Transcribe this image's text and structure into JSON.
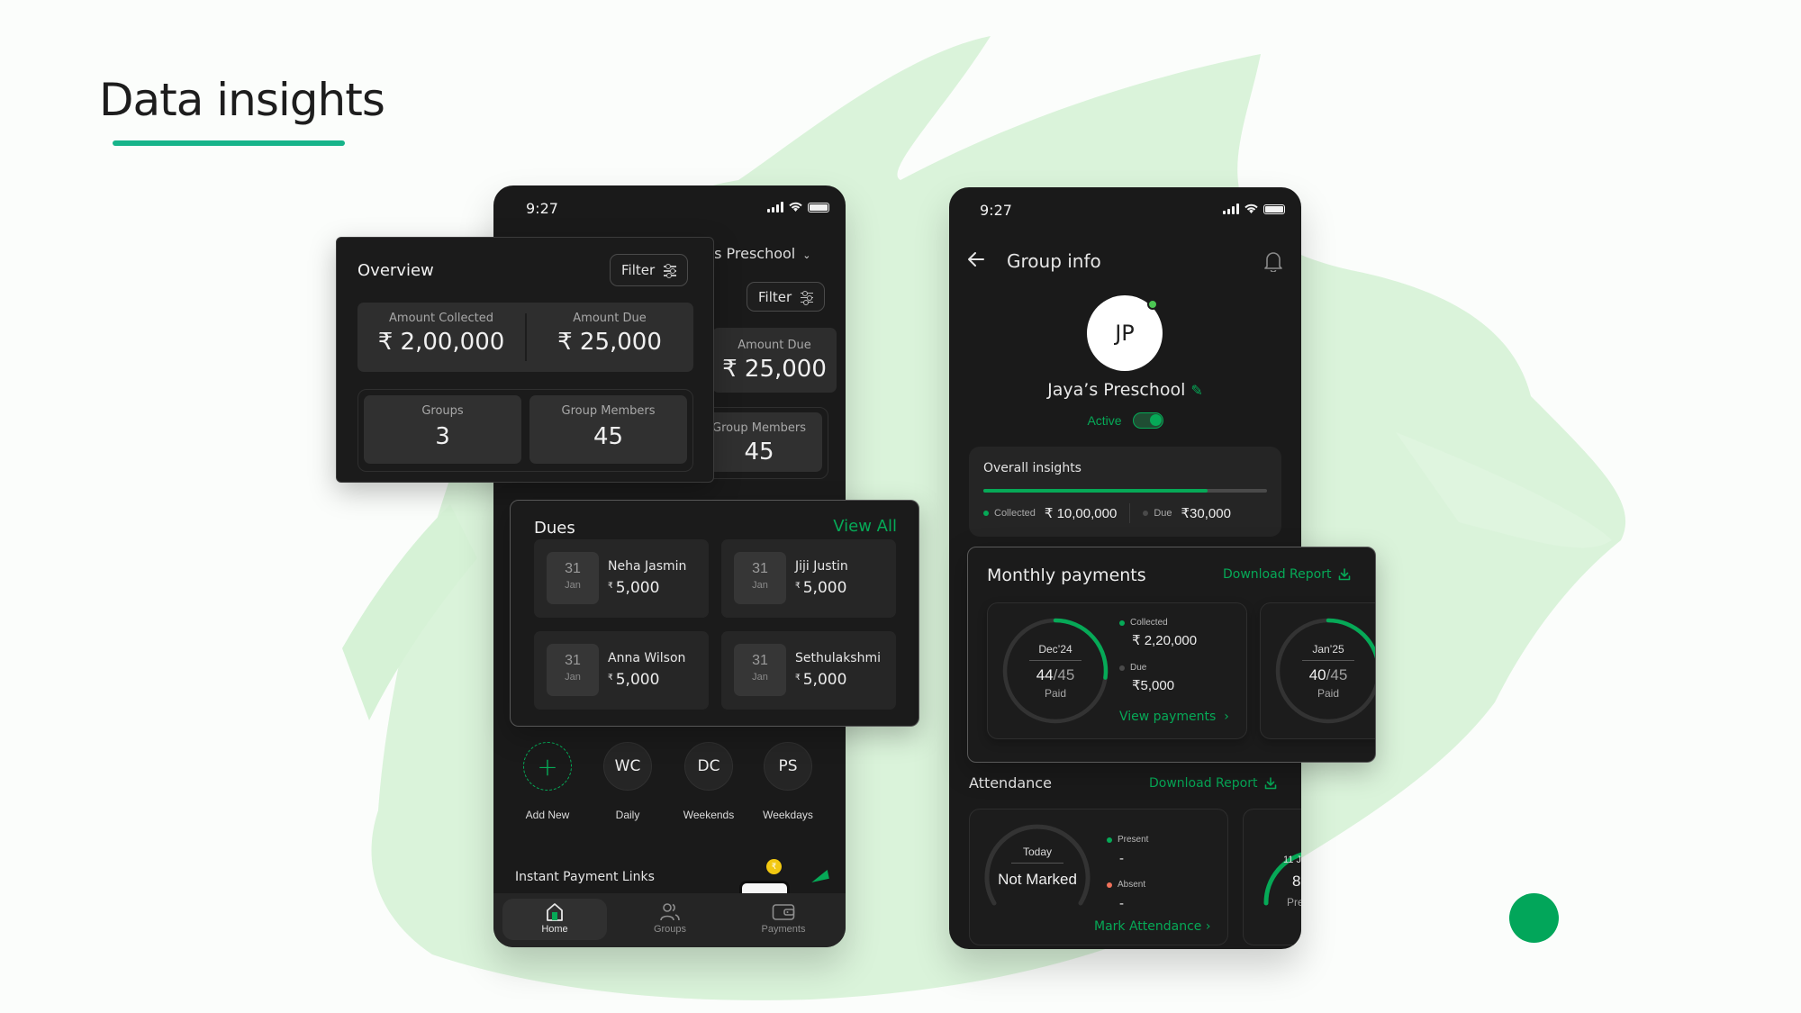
{
  "page": {
    "title": "Data insights",
    "accent": "#17b48a",
    "brand_green": "#06a957"
  },
  "left_phone": {
    "status": {
      "time": "9:27"
    },
    "school_selector": {
      "label": "’s Preschool",
      "icon": "chevron-down-icon"
    },
    "filter_label": "Filter",
    "amount_due": {
      "label": "Amount Due",
      "value": "₹ 25,000"
    },
    "group_members": {
      "label": "Group Members",
      "value": "45"
    },
    "groups_row": [
      {
        "initials": "+",
        "label": "Add New",
        "icon": "plus-icon"
      },
      {
        "initials": "WC",
        "label": "Daily"
      },
      {
        "initials": "DC",
        "label": "Weekends"
      },
      {
        "initials": "PS",
        "label": "Weekdays"
      }
    ],
    "instant_payment_links": {
      "label": "Instant Payment Links",
      "coin_symbol": "₹"
    },
    "bottom_nav": [
      {
        "label": "Home",
        "icon": "home-icon",
        "active": true
      },
      {
        "label": "Groups",
        "icon": "users-icon",
        "active": false
      },
      {
        "label": "Payments",
        "icon": "wallet-icon",
        "active": false
      }
    ]
  },
  "overview": {
    "title": "Overview",
    "filter_label": "Filter",
    "amount_collected": {
      "label": "Amount Collected",
      "value": "₹ 2,00,000"
    },
    "amount_due": {
      "label": "Amount Due",
      "value": "₹ 25,000"
    },
    "groups": {
      "label": "Groups",
      "value": "3"
    },
    "group_members": {
      "label": "Group Members",
      "value": "45"
    }
  },
  "dues": {
    "title": "Dues",
    "view_all": "View All",
    "currency": "₹",
    "items": [
      {
        "day": "31",
        "month": "Jan",
        "name": "Neha Jasmin",
        "amount": "5,000"
      },
      {
        "day": "31",
        "month": "Jan",
        "name": "Jiji Justin",
        "amount": "5,000"
      },
      {
        "day": "31",
        "month": "Jan",
        "name": "Anna Wilson",
        "amount": "5,000"
      },
      {
        "day": "31",
        "month": "Jan",
        "name": "Sethulakshmi",
        "amount": "5,000"
      }
    ]
  },
  "right_phone": {
    "status": {
      "time": "9:27"
    },
    "header": {
      "title": "Group info"
    },
    "avatar_initials": "JP",
    "group_name": "Jaya’s Preschool",
    "active_label": "Active",
    "active": true,
    "insights": {
      "title": "Overall insights",
      "collected_fraction": 0.79,
      "collected_label": "Collected",
      "collected_value": "₹ 10,00,000",
      "due_label": "Due",
      "due_value": "₹30,000"
    },
    "attendance": {
      "title": "Attendance",
      "download_label": "Download Report",
      "today": {
        "label": "Today",
        "status": "Not Marked",
        "present_label": "Present",
        "present_value": "-",
        "absent_label": "Absent",
        "absent_value": "-",
        "action": "Mark Attendance"
      },
      "next": {
        "label": "11 J",
        "value": "8",
        "sub": "Pre"
      }
    }
  },
  "monthly_payments": {
    "title": "Monthly payments",
    "download_label": "Download Report",
    "months": [
      {
        "month": "Dec’24",
        "paid": 44,
        "total": 45,
        "paid_label": "Paid",
        "collected_label": "Collected",
        "collected_value": "₹ 2,20,000",
        "due_label": "Due",
        "due_value": "₹5,000",
        "action": "View payments"
      },
      {
        "month": "Jan’25",
        "paid": 40,
        "total": 45,
        "paid_label": "Paid"
      }
    ]
  }
}
